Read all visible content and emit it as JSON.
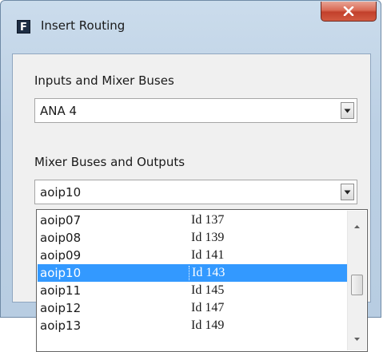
{
  "window": {
    "app_icon_letter": "F",
    "title": "Insert Routing"
  },
  "inputs": {
    "label": "Inputs and Mixer Buses",
    "selected_value": "ANA 4"
  },
  "outputs": {
    "label": "Mixer Buses and Outputs",
    "selected_value": "aoip10"
  },
  "list": {
    "items": [
      {
        "name": "aoip07",
        "id": "Id 137"
      },
      {
        "name": "aoip08",
        "id": "Id 139"
      },
      {
        "name": "aoip09",
        "id": "Id 141"
      },
      {
        "name": "aoip10",
        "id": "Id 143"
      },
      {
        "name": "aoip11",
        "id": "Id 145"
      },
      {
        "name": "aoip12",
        "id": "Id 147"
      },
      {
        "name": "aoip13",
        "id": "Id 149"
      }
    ],
    "selected_index": 3
  },
  "colors": {
    "selection": "#3399ff",
    "close_button": "#c9452f",
    "window_frame": "#bcd0e4"
  },
  "icons": {
    "close": "close-x-icon",
    "dropdown": "chevron-down-icon",
    "scroll_up": "scroll-up-arrow-icon",
    "scroll_down": "scroll-down-arrow-icon"
  }
}
